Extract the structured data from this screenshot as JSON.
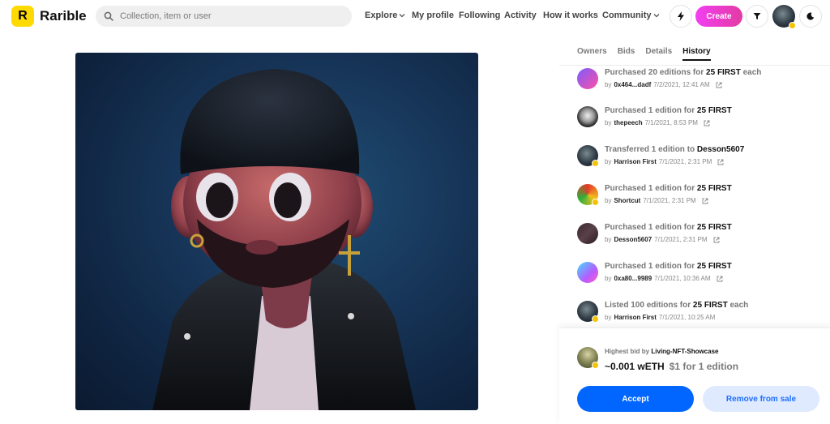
{
  "header": {
    "brand": "Rarible",
    "logo_letter": "R",
    "search_placeholder": "Collection, item or user",
    "nav": {
      "explore": "Explore",
      "my_profile": "My profile",
      "following": "Following",
      "activity": "Activity",
      "how_it_works": "How it works",
      "community": "Community"
    },
    "create_label": "Create",
    "icons": [
      "search-icon",
      "chevron-down-icon",
      "lightning-icon",
      "filter-icon",
      "moon-icon"
    ]
  },
  "tabs": [
    "Owners",
    "Bids",
    "Details",
    "History"
  ],
  "active_tab": "History",
  "history": [
    {
      "action": "Purchased 20 editions for",
      "price": "25 FIRST",
      "suffix": "each",
      "by": "0x464...dadf",
      "time": "7/2/2021, 12:41 AM",
      "badge": false
    },
    {
      "action": "Purchased 1 edition for",
      "price": "25 FIRST",
      "suffix": "",
      "by": "thepeech",
      "time": "7/1/2021, 8:53 PM",
      "badge": false
    },
    {
      "action": "Transferred 1 edition to",
      "price": "Desson5607",
      "suffix": "",
      "by": "Harrison First",
      "time": "7/1/2021, 2:31 PM",
      "badge": true
    },
    {
      "action": "Purchased 1 edition for",
      "price": "25 FIRST",
      "suffix": "",
      "by": "Shortcut",
      "time": "7/1/2021, 2:31 PM",
      "badge": true
    },
    {
      "action": "Purchased 1 edition for",
      "price": "25 FIRST",
      "suffix": "",
      "by": "Desson5607",
      "time": "7/1/2021, 2:31 PM",
      "badge": false
    },
    {
      "action": "Purchased 1 edition for",
      "price": "25 FIRST",
      "suffix": "",
      "by": "0xa80...9989",
      "time": "7/1/2021, 10:36 AM",
      "badge": false
    },
    {
      "action": "Listed 100 editions for",
      "price": "25 FIRST",
      "suffix": "each",
      "by": "Harrison First",
      "time": "7/1/2021, 10:25 AM",
      "badge": true
    }
  ],
  "by_label": "by",
  "highest_bid": {
    "label": "Highest bid by",
    "bidder": "Living-NFT-Showcase",
    "amount": "~0.001 wETH",
    "usd": "$1 for 1 edition"
  },
  "buttons": {
    "accept": "Accept",
    "remove": "Remove from sale"
  },
  "colors": {
    "accent_blue": "#0066ff",
    "create_pink": "#f23ef2",
    "logo_yellow": "#feda03",
    "verified_yellow": "#f5c400"
  }
}
